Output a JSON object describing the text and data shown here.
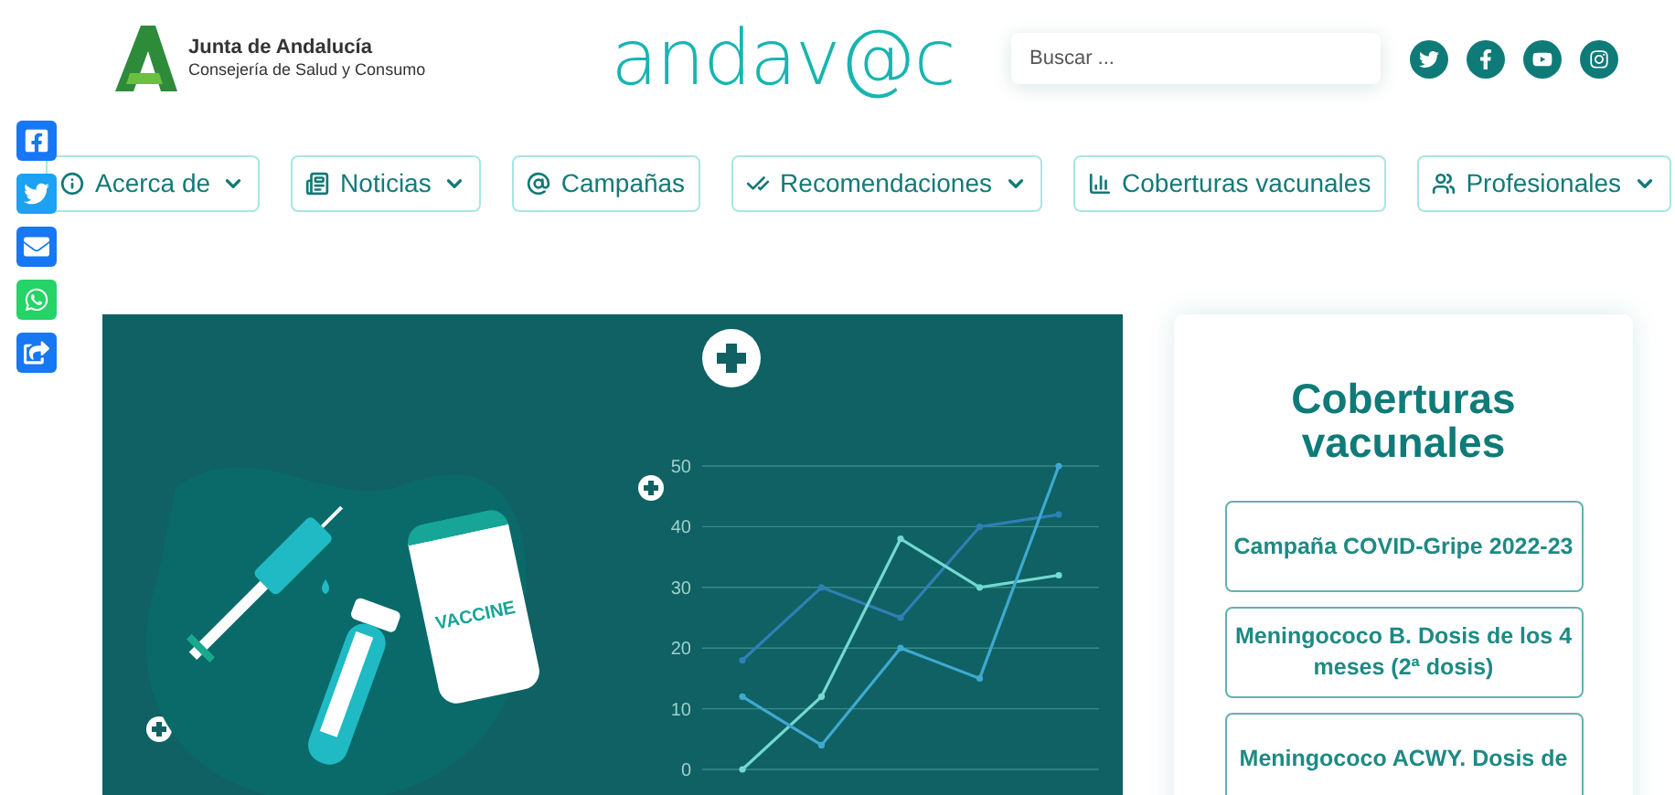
{
  "header": {
    "org_name": "Junta de Andalucía",
    "org_department": "Consejería de Salud y Consumo",
    "site_logo": "andav@c",
    "search": {
      "placeholder": "Buscar ..."
    }
  },
  "nav": [
    {
      "label": "Acerca de",
      "dropdown": true
    },
    {
      "label": "Noticias",
      "dropdown": true
    },
    {
      "label": "Campañas",
      "dropdown": false
    },
    {
      "label": "Recomendaciones",
      "dropdown": true
    },
    {
      "label": "Coberturas vacunales",
      "dropdown": false
    },
    {
      "label": "Profesionales",
      "dropdown": true
    }
  ],
  "hero": {
    "vial_label": "VACCINE",
    "chart_data": {
      "type": "line",
      "grid": true,
      "ylim": [
        0,
        50
      ],
      "yticks": [
        0,
        10,
        20,
        30,
        40,
        50
      ],
      "series": [
        {
          "color": "#2f7fb5",
          "marker": true,
          "values": [
            18,
            30,
            25,
            40,
            42
          ]
        },
        {
          "color": "#74d9d0",
          "marker": true,
          "values": [
            0,
            12,
            38,
            30,
            32
          ]
        },
        {
          "color": "#3fa9d0",
          "marker": true,
          "values": [
            12,
            4,
            20,
            15,
            50
          ]
        }
      ]
    }
  },
  "sidebar": {
    "title": "Coberturas vacunales",
    "links": [
      "Campaña COVID-Gripe 2022-23",
      "Meningococo B. Dosis de los 4 meses (2ª dosis)",
      "Meningococo ACWY. Dosis de"
    ]
  }
}
